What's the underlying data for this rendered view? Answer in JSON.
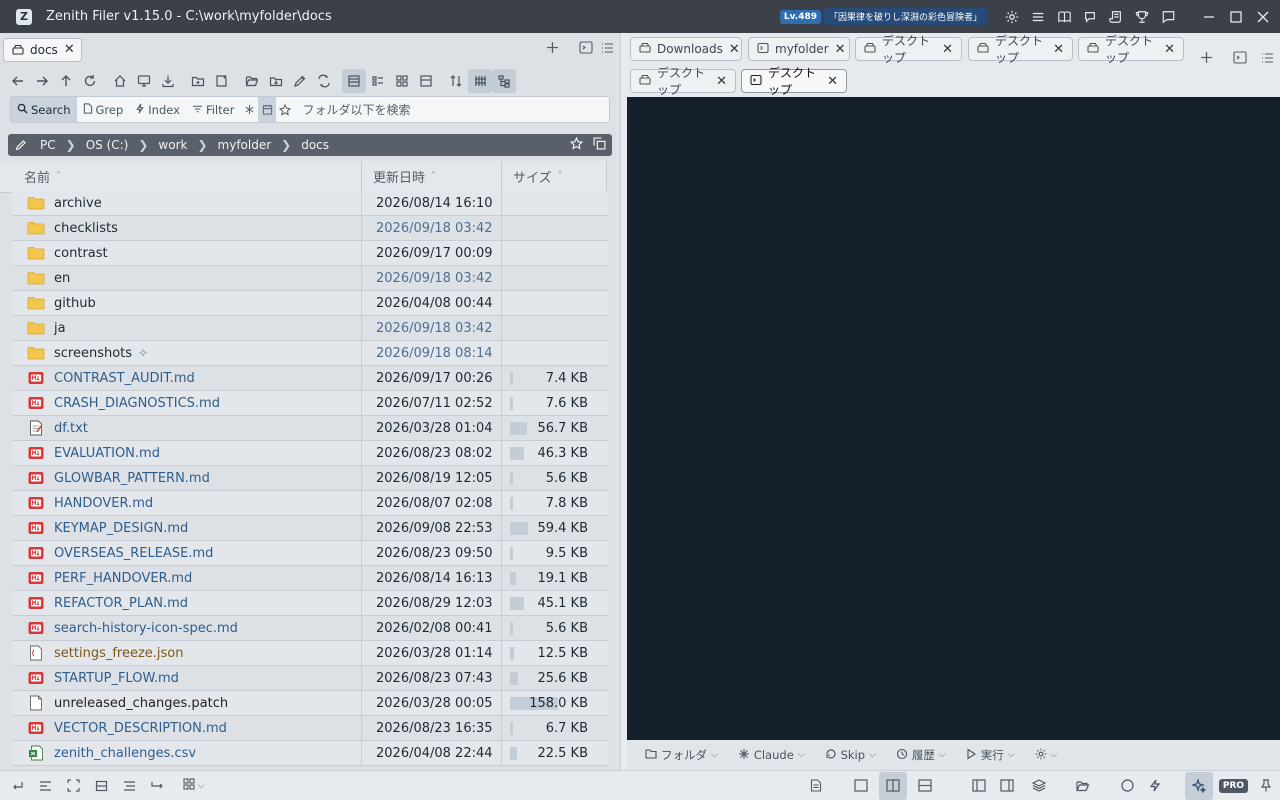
{
  "window": {
    "title": "Zenith Filer v1.15.0 - C:\\work\\myfolder\\docs",
    "logo_letter": "Z",
    "level": "Lv.489",
    "badge": "「因果律を破りし深淵の彩色冒険者」",
    "icons": [
      "gear-icon",
      "menu-icon",
      "book-icon",
      "chat-bubble-icon",
      "scroll-icon",
      "trophy-icon",
      "comment-icon"
    ]
  },
  "left_pane": {
    "tab": {
      "label": "docs",
      "close": "✕"
    },
    "search": {
      "tabs": [
        {
          "label": "Search",
          "active": true
        },
        {
          "label": "Grep",
          "active": false
        },
        {
          "label": "Index",
          "active": false
        },
        {
          "label": "Filter",
          "active": false
        }
      ],
      "placeholder": "フォルダ以下を検索"
    },
    "breadcrumb": [
      "PC",
      "OS (C:)",
      "work",
      "myfolder",
      "docs"
    ],
    "columns": {
      "name": "名前",
      "date": "更新日時",
      "size": "サイズ"
    },
    "files": [
      {
        "name": "archive",
        "type": "folder",
        "date": "2026/08/14 16:10",
        "recent": false,
        "size": "",
        "fill": 0
      },
      {
        "name": "checklists",
        "type": "folder",
        "date": "2026/09/18 03:42",
        "recent": true,
        "size": "",
        "fill": 0
      },
      {
        "name": "contrast",
        "type": "folder",
        "date": "2026/09/17 00:09",
        "recent": false,
        "size": "",
        "fill": 0
      },
      {
        "name": "en",
        "type": "folder",
        "date": "2026/09/18 03:42",
        "recent": true,
        "size": "",
        "fill": 0
      },
      {
        "name": "github",
        "type": "folder",
        "date": "2026/04/08 00:44",
        "recent": false,
        "size": "",
        "fill": 0
      },
      {
        "name": "ja",
        "type": "folder",
        "date": "2026/09/18 03:42",
        "recent": true,
        "size": "",
        "fill": 0
      },
      {
        "name": "screenshots",
        "type": "folder",
        "date": "2026/09/18 08:14",
        "recent": true,
        "size": "",
        "fill": 0,
        "sparkle": true
      },
      {
        "name": "CONTRAST_AUDIT.md",
        "type": "md",
        "date": "2026/09/17 00:26",
        "recent": false,
        "size": "7.4 KB",
        "fill": 0.05
      },
      {
        "name": "CRASH_DIAGNOSTICS.md",
        "type": "md",
        "date": "2026/07/11 02:52",
        "recent": false,
        "size": "7.6 KB",
        "fill": 0.05
      },
      {
        "name": "df.txt",
        "type": "txt",
        "date": "2026/03/28 01:04",
        "recent": false,
        "size": "56.7 KB",
        "fill": 0.36
      },
      {
        "name": "EVALUATION.md",
        "type": "md",
        "date": "2026/08/23 08:02",
        "recent": false,
        "size": "46.3 KB",
        "fill": 0.29
      },
      {
        "name": "GLOWBAR_PATTERN.md",
        "type": "md",
        "date": "2026/08/19 12:05",
        "recent": false,
        "size": "5.6 KB",
        "fill": 0.04
      },
      {
        "name": "HANDOVER.md",
        "type": "md",
        "date": "2026/08/07 02:08",
        "recent": false,
        "size": "7.8 KB",
        "fill": 0.05
      },
      {
        "name": "KEYMAP_DESIGN.md",
        "type": "md",
        "date": "2026/09/08 22:53",
        "recent": false,
        "size": "59.4 KB",
        "fill": 0.38
      },
      {
        "name": "OVERSEAS_RELEASE.md",
        "type": "md",
        "date": "2026/08/23 09:50",
        "recent": false,
        "size": "9.5 KB",
        "fill": 0.06
      },
      {
        "name": "PERF_HANDOVER.md",
        "type": "md",
        "date": "2026/08/14 16:13",
        "recent": false,
        "size": "19.1 KB",
        "fill": 0.12
      },
      {
        "name": "REFACTOR_PLAN.md",
        "type": "md",
        "date": "2026/08/29 12:03",
        "recent": false,
        "size": "45.1 KB",
        "fill": 0.29
      },
      {
        "name": "search-history-icon-spec.md",
        "type": "md",
        "date": "2026/02/08 00:41",
        "recent": false,
        "size": "5.6 KB",
        "fill": 0.04
      },
      {
        "name": "settings_freeze.json",
        "type": "json",
        "date": "2026/03/28 01:14",
        "recent": false,
        "size": "12.5 KB",
        "fill": 0.08
      },
      {
        "name": "STARTUP_FLOW.md",
        "type": "md",
        "date": "2026/08/23 07:43",
        "recent": false,
        "size": "25.6 KB",
        "fill": 0.16
      },
      {
        "name": "unreleased_changes.patch",
        "type": "plain",
        "date": "2026/03/28 00:05",
        "recent": false,
        "size": "158.0 KB",
        "fill": 1.0
      },
      {
        "name": "VECTOR_DESCRIPTION.md",
        "type": "md",
        "date": "2026/08/23 16:35",
        "recent": false,
        "size": "6.7 KB",
        "fill": 0.04
      },
      {
        "name": "zenith_challenges.csv",
        "type": "csv",
        "date": "2026/04/08 22:44",
        "recent": false,
        "size": "22.5 KB",
        "fill": 0.14
      }
    ]
  },
  "right_pane": {
    "tabs": [
      {
        "label": "Downloads",
        "icon": "drive-icon",
        "active": false
      },
      {
        "label": "myfolder",
        "icon": "terminal-icon",
        "active": false
      },
      {
        "label": "デスクトップ",
        "icon": "drive-icon",
        "active": false
      },
      {
        "label": "デスクトップ",
        "icon": "drive-icon",
        "active": false
      },
      {
        "label": "デスクトップ",
        "icon": "drive-icon",
        "active": false
      },
      {
        "label": "デスクトップ",
        "icon": "drive-icon",
        "active": false
      },
      {
        "label": "デスクトップ",
        "icon": "terminal-icon",
        "active": true
      }
    ],
    "terminal_toolbar": [
      {
        "label": "フォルダ",
        "icon": "folder-icon"
      },
      {
        "label": "Claude",
        "icon": "claude-icon"
      },
      {
        "label": "Skip",
        "icon": "skip-icon"
      },
      {
        "label": "履歴",
        "icon": "history-icon"
      },
      {
        "label": "実行",
        "icon": "play-icon"
      },
      {
        "label": "",
        "icon": "gear-icon"
      }
    ],
    "terminal_bg": "#16202b"
  },
  "statusbar": {
    "pro_label": "PRO"
  },
  "colors": {
    "titlebar": "#3c4049",
    "accent": "#2e6fb0",
    "link_text": "#2f5e8c",
    "recent_date": "#4d6f92"
  }
}
